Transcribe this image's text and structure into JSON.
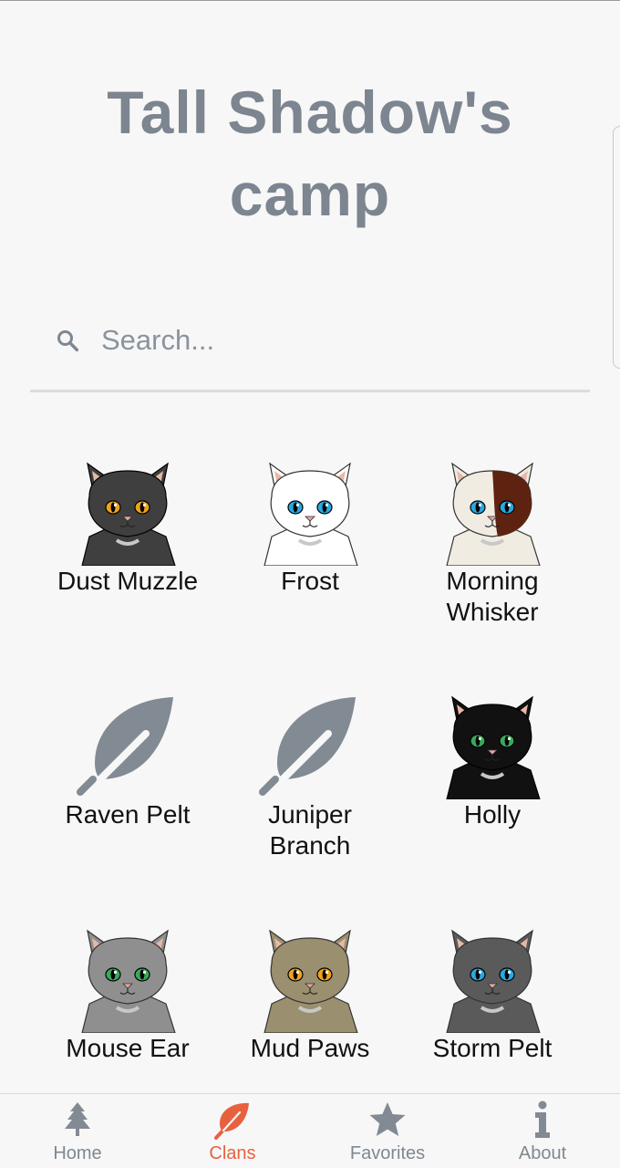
{
  "page": {
    "title": "Tall Shadow's camp"
  },
  "search": {
    "placeholder": "Search..."
  },
  "cats": [
    {
      "name": "Dust Muzzle",
      "image": "cat-portrait",
      "fur": "#3f3f3f",
      "eyes": "#f0a21c"
    },
    {
      "name": "Frost",
      "image": "cat-portrait",
      "fur": "#ffffff",
      "eyes": "#29a8e0"
    },
    {
      "name": "Morning Whisker",
      "image": "cat-portrait",
      "fur": "#f0ece2",
      "patch": "#5e2310",
      "eyes": "#29a8e0"
    },
    {
      "name": "Raven Pelt",
      "image": "feather-placeholder",
      "fur": "#828a93"
    },
    {
      "name": "Juniper Branch",
      "image": "feather-placeholder",
      "fur": "#828a93"
    },
    {
      "name": "Holly",
      "image": "cat-portrait",
      "fur": "#111111",
      "eyes": "#3aa85a"
    },
    {
      "name": "Mouse Ear",
      "image": "cat-portrait",
      "fur": "#8f8f8f",
      "eyes": "#3aa85a"
    },
    {
      "name": "Mud Paws",
      "image": "cat-portrait",
      "fur": "#9a8f6e",
      "eyes": "#f0a21c"
    },
    {
      "name": "Storm Pelt",
      "image": "cat-portrait",
      "fur": "#5a5a5a",
      "eyes": "#29a8e0"
    }
  ],
  "nav": [
    {
      "label": "Home",
      "icon": "tree-icon",
      "active": false
    },
    {
      "label": "Clans",
      "icon": "leaf-icon",
      "active": true
    },
    {
      "label": "Favorites",
      "icon": "star-icon",
      "active": false
    },
    {
      "label": "About",
      "icon": "info-icon",
      "active": false
    }
  ],
  "colors": {
    "accent": "#e8613f",
    "muted": "#7f8891",
    "icon_gray": "#828a93"
  }
}
